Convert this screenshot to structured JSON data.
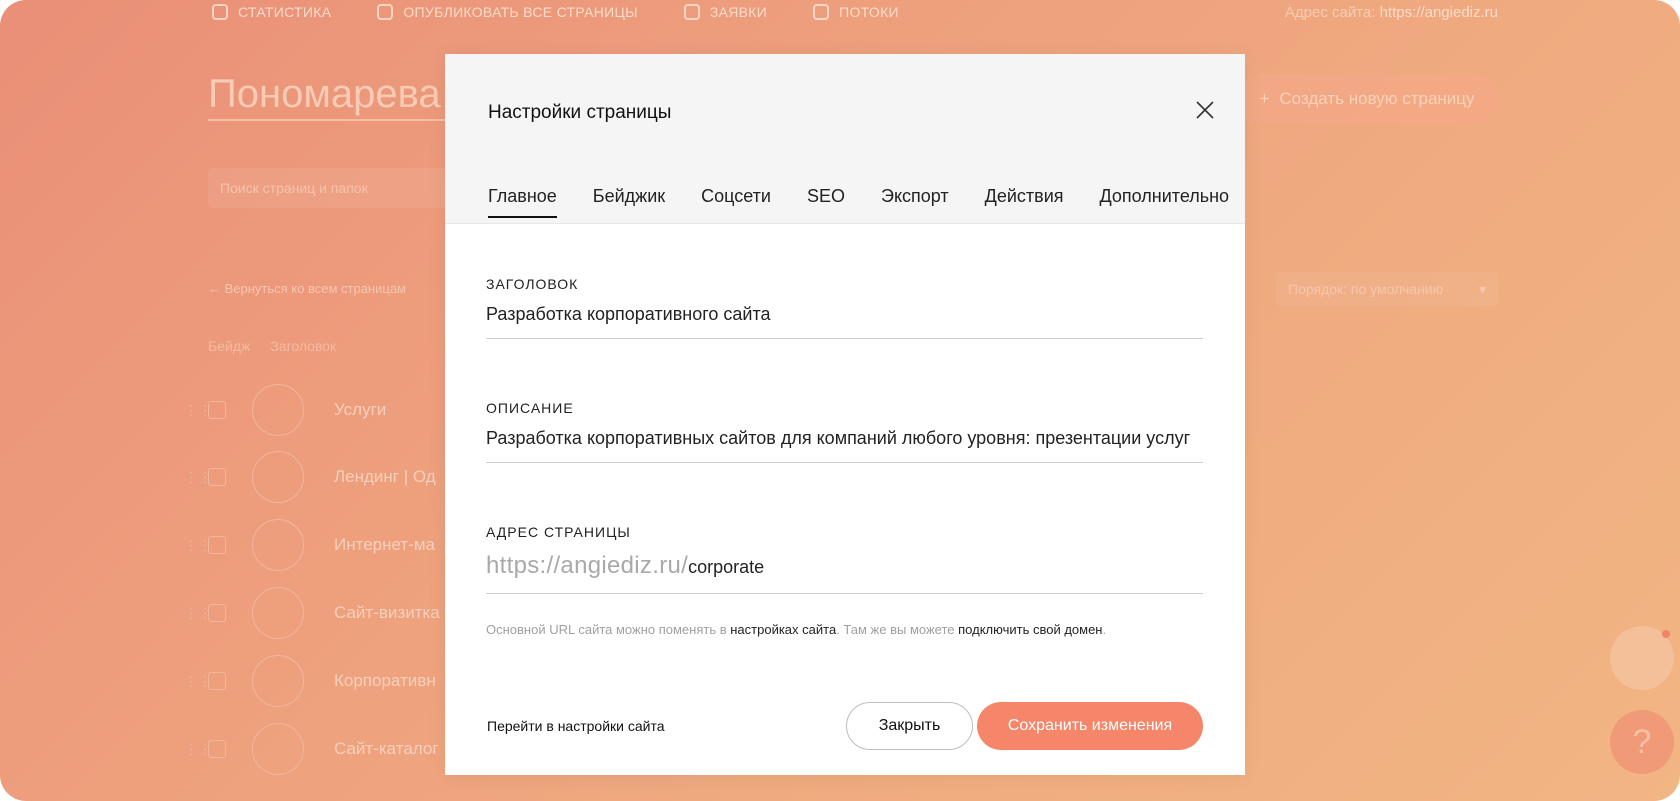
{
  "background": {
    "nav": [
      {
        "label": "СТАТИСТИКА",
        "icon": "pie-chart-icon"
      },
      {
        "label": "ОПУБЛИКОВАТЬ ВСЕ СТРАНИЦЫ",
        "icon": "upload-icon"
      },
      {
        "label": "ЗАЯВКИ",
        "icon": "list-icon"
      },
      {
        "label": "ПОТОКИ",
        "icon": "megaphone-icon"
      }
    ],
    "site_address_label": "Адрес сайта:",
    "site_address_value": "https://angiediz.ru",
    "project_title": "Пономарева А",
    "create_button": "Создать новую страницу",
    "search_placeholder": "Поиск страниц и папок",
    "back_link": "← Вернуться ко всем страницам",
    "sort_label": "Порядок: по умолчанию",
    "list_header": {
      "badge": "Бейдж",
      "title": "Заголовок"
    },
    "rows": [
      "Услуги",
      "Лендинг | Од",
      "Интернет-ма",
      "Сайт-визитка",
      "Корпоративн",
      "Сайт-каталог"
    ],
    "help_symbol": "?"
  },
  "modal": {
    "title": "Настройки страницы",
    "tabs": [
      "Главное",
      "Бейджик",
      "Соцсети",
      "SEO",
      "Экспорт",
      "Действия",
      "Дополнительно"
    ],
    "active_tab": 0,
    "fields": {
      "title_label": "Заголовок",
      "title_value": "Разработка  корпоративного сайта",
      "description_label": "Описание",
      "description_value": "Разработка корпоративных сайтов для компаний любого уровня: презентации услуг",
      "address_label": "Адрес страницы",
      "address_prefix": "https://angiediz.ru/",
      "address_value": "corporate"
    },
    "hint": {
      "part1": "Основной URL сайта можно поменять в ",
      "link1": "настройках сайта",
      "part2": ". Там же вы можете ",
      "link2": "подключить свой домен",
      "part3": "."
    },
    "footer": {
      "goto_settings": "Перейти в настройки сайта",
      "close": "Закрыть",
      "save": "Сохранить изменения"
    }
  },
  "colors": {
    "accent": "#f5866a",
    "backdrop_start": "#ea8f78",
    "backdrop_end": "#f2b584"
  }
}
